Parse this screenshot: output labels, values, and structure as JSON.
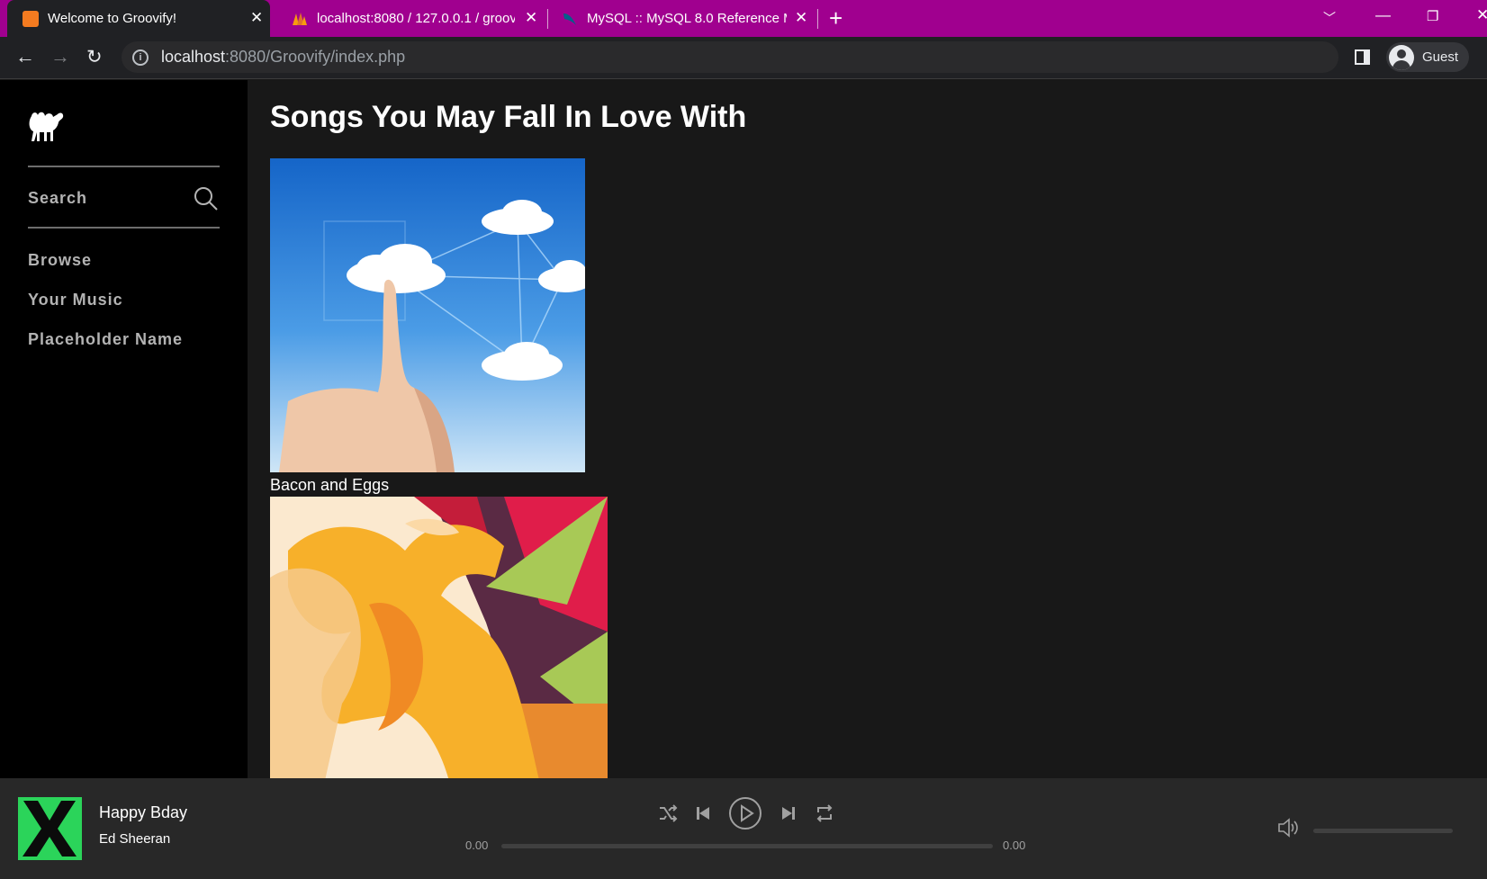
{
  "browser": {
    "tabs": [
      {
        "title": "Welcome to Groovify!",
        "active": true,
        "favicon_color": "#f47b20"
      },
      {
        "title": "localhost:8080 / 127.0.0.1 / groov",
        "active": false,
        "favicon_color": "#f89c0e"
      },
      {
        "title": "MySQL :: MySQL 8.0 Reference M",
        "active": false,
        "favicon_color": "#00618a"
      }
    ],
    "new_tab_label": "+",
    "url_host": "localhost",
    "url_rest": ":8080/Groovify/index.php",
    "profile_name": "Guest",
    "accent_color": "#a0008f"
  },
  "sidebar": {
    "logo_icon": "camel-icon",
    "search_label": "Search",
    "links": [
      {
        "label": "Browse"
      },
      {
        "label": "Your Music"
      },
      {
        "label": "Placeholder Name"
      }
    ]
  },
  "main": {
    "heading": "Songs You May Fall In Love With",
    "albums": [
      {
        "title": "Bacon and Eggs",
        "art": "cloud-network-art"
      },
      {
        "title": "",
        "art": "running-figures-art"
      }
    ]
  },
  "player": {
    "song": "Happy Bday",
    "artist": "Ed Sheeran",
    "album_art_color": "#2bd45a",
    "current_time": "0.00",
    "total_time": "0.00",
    "progress": 0,
    "volume": 0,
    "controls": [
      "shuffle-icon",
      "previous-icon",
      "play-icon",
      "next-icon",
      "repeat-icon"
    ]
  }
}
